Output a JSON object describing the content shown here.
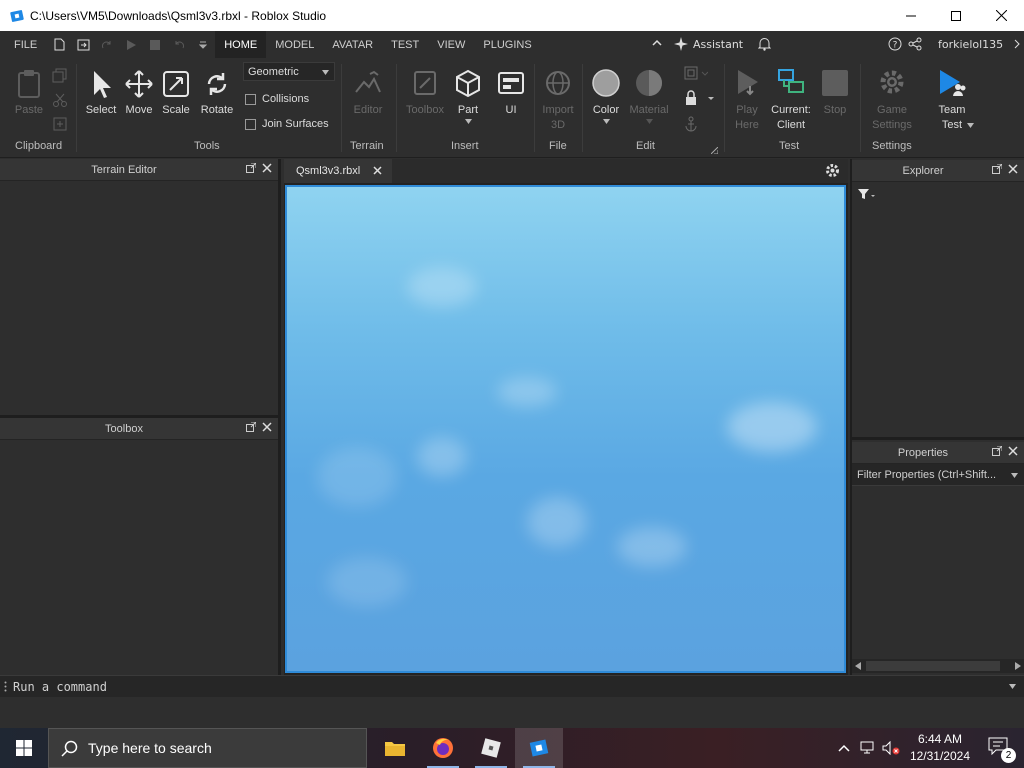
{
  "window": {
    "title": "C:\\Users\\VM5\\Downloads\\Qsml3v3.rbxl - Roblox Studio"
  },
  "menu": {
    "file": "FILE",
    "tabs": [
      "HOME",
      "MODEL",
      "AVATAR",
      "TEST",
      "VIEW",
      "PLUGINS"
    ],
    "active_tab": "HOME",
    "assistant": "Assistant",
    "username": "forkielol135"
  },
  "ribbon": {
    "clipboard": {
      "paste": "Paste",
      "group": "Clipboard"
    },
    "tools": {
      "select": "Select",
      "move": "Move",
      "scale": "Scale",
      "rotate": "Rotate",
      "mode": "Geometric",
      "collisions": "Collisions",
      "join_surfaces": "Join Surfaces",
      "group": "Tools"
    },
    "terrain": {
      "editor": "Editor",
      "group": "Terrain"
    },
    "insert": {
      "toolbox": "Toolbox",
      "part": "Part",
      "ui": "UI",
      "group": "Insert"
    },
    "file": {
      "import_line1": "Import",
      "import_line2": "3D",
      "group": "File"
    },
    "edit": {
      "color": "Color",
      "material": "Material",
      "group": "Edit"
    },
    "test": {
      "play_line1": "Play",
      "play_line2": "Here",
      "current_line1": "Current:",
      "current_line2": "Client",
      "stop": "Stop",
      "group": "Test"
    },
    "settings": {
      "game_line1": "Game",
      "game_line2": "Settings",
      "team_line1": "Team",
      "team_line2": "Test",
      "group": "Settings"
    }
  },
  "panels": {
    "terrain_editor": "Terrain Editor",
    "toolbox": "Toolbox",
    "explorer": "Explorer",
    "properties": "Properties",
    "filter_properties": "Filter Properties (Ctrl+Shift..."
  },
  "document_tab": "Qsml3v3.rbxl",
  "command_bar": {
    "placeholder": "Run a command"
  },
  "taskbar": {
    "search_placeholder": "Type here to search",
    "time": "6:44 AM",
    "date": "12/31/2024",
    "notification_count": "2"
  }
}
